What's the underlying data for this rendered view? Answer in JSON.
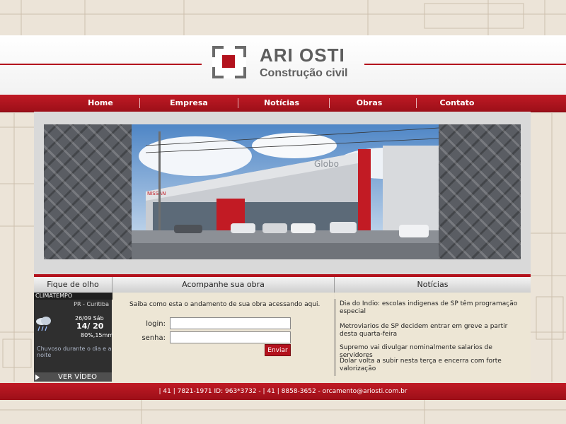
{
  "brand": {
    "title": "ARI OSTI",
    "subtitle": "Construção civil",
    "accent_color": "#b3121d"
  },
  "nav": {
    "items": [
      {
        "label": "Home"
      },
      {
        "label": "Empresa"
      },
      {
        "label": "Notícias"
      },
      {
        "label": "Obras"
      },
      {
        "label": "Contato"
      }
    ]
  },
  "banner": {
    "sign_text": "Globo",
    "brand_text": "NISSAN"
  },
  "sections": {
    "left_header": "Fique de olho",
    "mid_header": "Acompanhe sua obra",
    "right_header": "Notícias"
  },
  "weather": {
    "widget_label": "CLIMATEMPO",
    "location": "PR - Curitiba",
    "date": "26/09 Sáb",
    "temps": "14/ 20",
    "rain": "80%,15mm",
    "description": "Chuvoso durante o dia e a noite",
    "video_label": "VER VÍDEO"
  },
  "login": {
    "intro": "Saiba como esta o andamento de sua obra acessando aqui.",
    "login_label": "login:",
    "password_label": "senha:",
    "login_value": "",
    "password_value": "",
    "submit_label": "Enviar"
  },
  "news": [
    {
      "text": "Dia do Indio: escolas indigenas de SP têm programação especial"
    },
    {
      "text": "Metroviarios de SP decidem entrar em greve a partir desta quarta-feira"
    },
    {
      "text": "Supremo vai divulgar nominalmente salarios de servidores"
    },
    {
      "text": "Dolar volta a subir nesta terça e encerra com forte valorização"
    }
  ],
  "footer": {
    "text": "| 41 | 7821-1971 ID: 963*3732 - | 41 | 8858-3652 - orcamento@ariosti.com.br"
  }
}
